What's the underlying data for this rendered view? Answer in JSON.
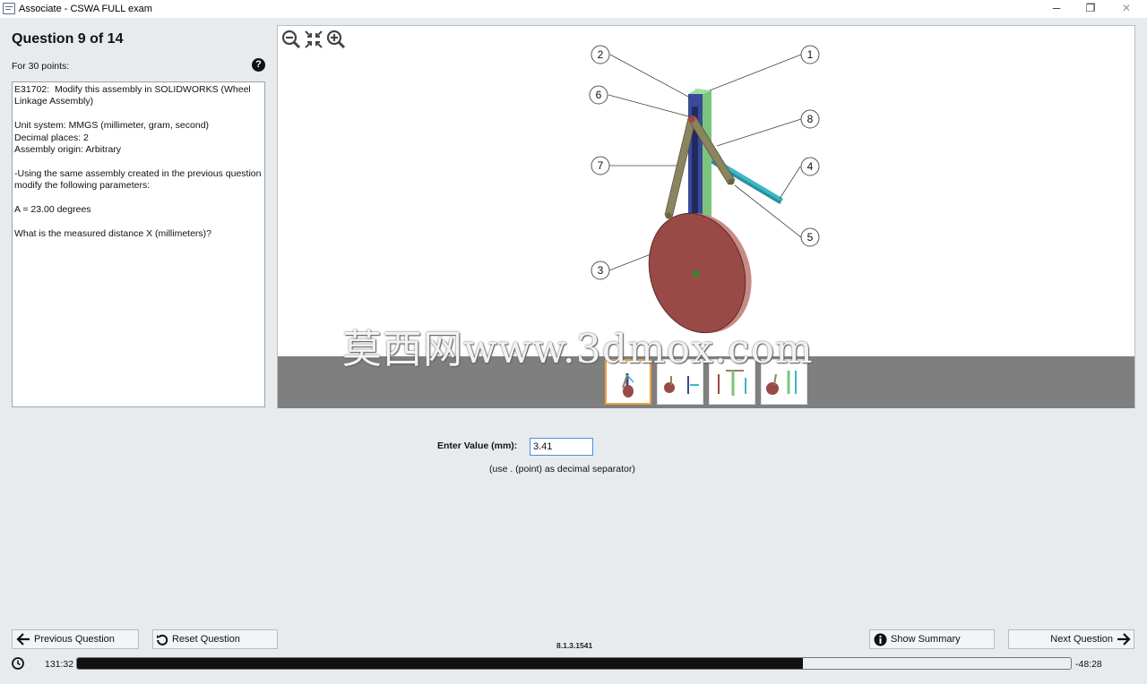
{
  "window": {
    "title": "Associate - CSWA FULL exam",
    "minimize_glyph": "─",
    "maximize_glyph": "❐",
    "close_glyph": "✕"
  },
  "question": {
    "title": "Question 9 of 14",
    "points": "For 30 points:",
    "help_glyph": "?",
    "text": "E31702:  Modify this assembly in SOLIDWORKS (Wheel Linkage Assembly)\n\nUnit system: MMGS (millimeter, gram, second)\nDecimal places: 2\nAssembly origin: Arbitrary\n\n-Using the same assembly created in the previous question modify the following parameters:\n\nA = 23.00 degrees\n\nWhat is the measured distance X (millimeters)?"
  },
  "viewer": {
    "toolbar": [
      "zoom-out-icon",
      "fit-to-screen-icon",
      "zoom-in-icon"
    ],
    "callouts": [
      "1",
      "2",
      "3",
      "4",
      "5",
      "6",
      "7",
      "8"
    ],
    "thumbnails": {
      "count": 4,
      "active_index": 0
    },
    "watermark": "莫西网www.3dmox.com"
  },
  "answer": {
    "label": "Enter Value (mm):",
    "value": "3.41",
    "hint": "(use . (point) as decimal separator)"
  },
  "footer": {
    "prev_label": "Previous Question",
    "reset_label": "Reset Question",
    "summary_label": "Show Summary",
    "next_label": "Next Question",
    "version": "8.1.3.1541",
    "elapsed": "131:32",
    "remaining": "-48:28",
    "progress_fraction": 0.73
  },
  "colors": {
    "wheel": "#9a4a46",
    "links": "#8a8560",
    "upright_blue": "#3a4a9a",
    "upright_green": "#7cc47c",
    "shaft": "#3bb8c8",
    "thumb_active": "#f0a040"
  }
}
